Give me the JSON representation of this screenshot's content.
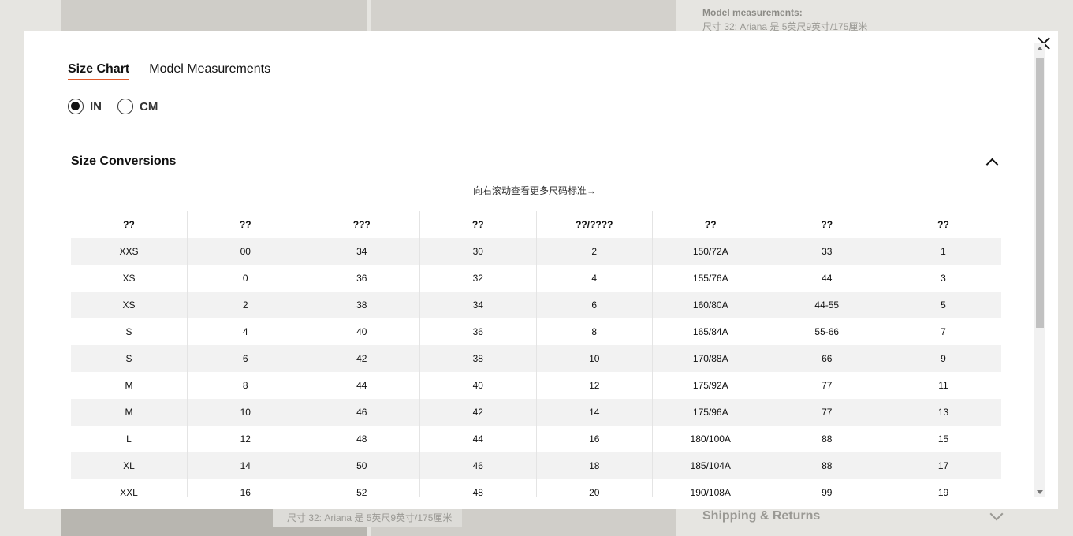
{
  "background": {
    "model_title": "Model measurements:",
    "model_text": "尺寸 32: Ariana 是 5英尺9英寸/175厘米",
    "caption_text": "尺寸 32: Ariana 是 5英尺9英寸/175厘米",
    "shipping_label": "Shipping & Returns"
  },
  "modal": {
    "tabs": [
      {
        "label": "Size Chart",
        "active": true
      },
      {
        "label": "Model Measurements",
        "active": false
      }
    ],
    "units": [
      {
        "label": "IN",
        "selected": true
      },
      {
        "label": "CM",
        "selected": false
      }
    ],
    "section_title": "Size Conversions",
    "scroll_hint": "向右滚动查看更多尺码标准→",
    "table": {
      "headers": [
        "??",
        "??",
        "???",
        "??",
        "??/????",
        "??",
        "??",
        "??"
      ],
      "rows": [
        [
          "XXS",
          "00",
          "34",
          "30",
          "2",
          "150/72A",
          "33",
          "1"
        ],
        [
          "XS",
          "0",
          "36",
          "32",
          "4",
          "155/76A",
          "44",
          "3"
        ],
        [
          "XS",
          "2",
          "38",
          "34",
          "6",
          "160/80A",
          "44-55",
          "5"
        ],
        [
          "S",
          "4",
          "40",
          "36",
          "8",
          "165/84A",
          "55-66",
          "7"
        ],
        [
          "S",
          "6",
          "42",
          "38",
          "10",
          "170/88A",
          "66",
          "9"
        ],
        [
          "M",
          "8",
          "44",
          "40",
          "12",
          "175/92A",
          "77",
          "11"
        ],
        [
          "M",
          "10",
          "46",
          "42",
          "14",
          "175/96A",
          "77",
          "13"
        ],
        [
          "L",
          "12",
          "48",
          "44",
          "16",
          "180/100A",
          "88",
          "15"
        ],
        [
          "XL",
          "14",
          "50",
          "46",
          "18",
          "185/104A",
          "88",
          "17"
        ],
        [
          "XXL",
          "16",
          "52",
          "48",
          "20",
          "190/108A",
          "99",
          "19"
        ]
      ]
    }
  },
  "icons": {
    "close": "close-icon",
    "collapse": "chevron-up-icon",
    "shipping_expand": "chevron-down-icon"
  }
}
